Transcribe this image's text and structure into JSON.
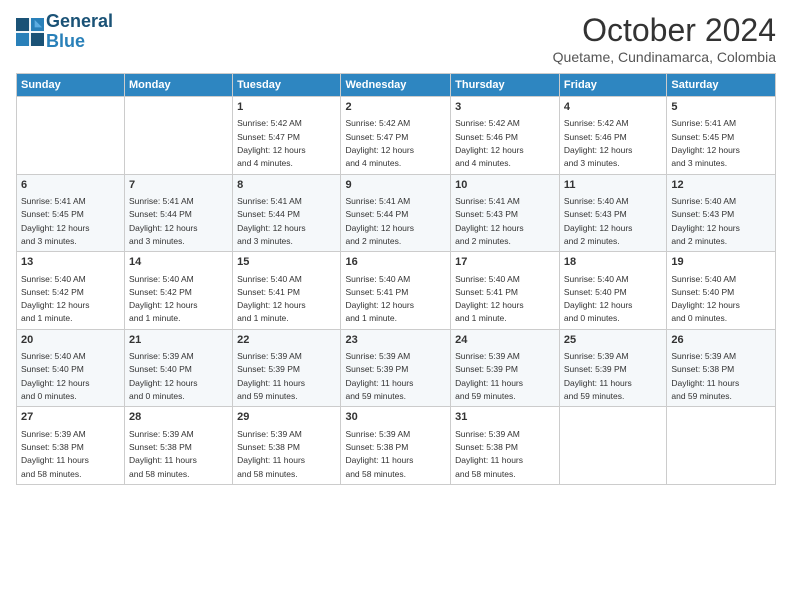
{
  "logo": {
    "line1": "General",
    "line2": "Blue"
  },
  "title": "October 2024",
  "location": "Quetame, Cundinamarca, Colombia",
  "days_of_week": [
    "Sunday",
    "Monday",
    "Tuesday",
    "Wednesday",
    "Thursday",
    "Friday",
    "Saturday"
  ],
  "weeks": [
    [
      {
        "day": "",
        "info": ""
      },
      {
        "day": "",
        "info": ""
      },
      {
        "day": "1",
        "info": "Sunrise: 5:42 AM\nSunset: 5:47 PM\nDaylight: 12 hours\nand 4 minutes."
      },
      {
        "day": "2",
        "info": "Sunrise: 5:42 AM\nSunset: 5:47 PM\nDaylight: 12 hours\nand 4 minutes."
      },
      {
        "day": "3",
        "info": "Sunrise: 5:42 AM\nSunset: 5:46 PM\nDaylight: 12 hours\nand 4 minutes."
      },
      {
        "day": "4",
        "info": "Sunrise: 5:42 AM\nSunset: 5:46 PM\nDaylight: 12 hours\nand 3 minutes."
      },
      {
        "day": "5",
        "info": "Sunrise: 5:41 AM\nSunset: 5:45 PM\nDaylight: 12 hours\nand 3 minutes."
      }
    ],
    [
      {
        "day": "6",
        "info": "Sunrise: 5:41 AM\nSunset: 5:45 PM\nDaylight: 12 hours\nand 3 minutes."
      },
      {
        "day": "7",
        "info": "Sunrise: 5:41 AM\nSunset: 5:44 PM\nDaylight: 12 hours\nand 3 minutes."
      },
      {
        "day": "8",
        "info": "Sunrise: 5:41 AM\nSunset: 5:44 PM\nDaylight: 12 hours\nand 3 minutes."
      },
      {
        "day": "9",
        "info": "Sunrise: 5:41 AM\nSunset: 5:44 PM\nDaylight: 12 hours\nand 2 minutes."
      },
      {
        "day": "10",
        "info": "Sunrise: 5:41 AM\nSunset: 5:43 PM\nDaylight: 12 hours\nand 2 minutes."
      },
      {
        "day": "11",
        "info": "Sunrise: 5:40 AM\nSunset: 5:43 PM\nDaylight: 12 hours\nand 2 minutes."
      },
      {
        "day": "12",
        "info": "Sunrise: 5:40 AM\nSunset: 5:43 PM\nDaylight: 12 hours\nand 2 minutes."
      }
    ],
    [
      {
        "day": "13",
        "info": "Sunrise: 5:40 AM\nSunset: 5:42 PM\nDaylight: 12 hours\nand 1 minute."
      },
      {
        "day": "14",
        "info": "Sunrise: 5:40 AM\nSunset: 5:42 PM\nDaylight: 12 hours\nand 1 minute."
      },
      {
        "day": "15",
        "info": "Sunrise: 5:40 AM\nSunset: 5:41 PM\nDaylight: 12 hours\nand 1 minute."
      },
      {
        "day": "16",
        "info": "Sunrise: 5:40 AM\nSunset: 5:41 PM\nDaylight: 12 hours\nand 1 minute."
      },
      {
        "day": "17",
        "info": "Sunrise: 5:40 AM\nSunset: 5:41 PM\nDaylight: 12 hours\nand 1 minute."
      },
      {
        "day": "18",
        "info": "Sunrise: 5:40 AM\nSunset: 5:40 PM\nDaylight: 12 hours\nand 0 minutes."
      },
      {
        "day": "19",
        "info": "Sunrise: 5:40 AM\nSunset: 5:40 PM\nDaylight: 12 hours\nand 0 minutes."
      }
    ],
    [
      {
        "day": "20",
        "info": "Sunrise: 5:40 AM\nSunset: 5:40 PM\nDaylight: 12 hours\nand 0 minutes."
      },
      {
        "day": "21",
        "info": "Sunrise: 5:39 AM\nSunset: 5:40 PM\nDaylight: 12 hours\nand 0 minutes."
      },
      {
        "day": "22",
        "info": "Sunrise: 5:39 AM\nSunset: 5:39 PM\nDaylight: 11 hours\nand 59 minutes."
      },
      {
        "day": "23",
        "info": "Sunrise: 5:39 AM\nSunset: 5:39 PM\nDaylight: 11 hours\nand 59 minutes."
      },
      {
        "day": "24",
        "info": "Sunrise: 5:39 AM\nSunset: 5:39 PM\nDaylight: 11 hours\nand 59 minutes."
      },
      {
        "day": "25",
        "info": "Sunrise: 5:39 AM\nSunset: 5:39 PM\nDaylight: 11 hours\nand 59 minutes."
      },
      {
        "day": "26",
        "info": "Sunrise: 5:39 AM\nSunset: 5:38 PM\nDaylight: 11 hours\nand 59 minutes."
      }
    ],
    [
      {
        "day": "27",
        "info": "Sunrise: 5:39 AM\nSunset: 5:38 PM\nDaylight: 11 hours\nand 58 minutes."
      },
      {
        "day": "28",
        "info": "Sunrise: 5:39 AM\nSunset: 5:38 PM\nDaylight: 11 hours\nand 58 minutes."
      },
      {
        "day": "29",
        "info": "Sunrise: 5:39 AM\nSunset: 5:38 PM\nDaylight: 11 hours\nand 58 minutes."
      },
      {
        "day": "30",
        "info": "Sunrise: 5:39 AM\nSunset: 5:38 PM\nDaylight: 11 hours\nand 58 minutes."
      },
      {
        "day": "31",
        "info": "Sunrise: 5:39 AM\nSunset: 5:38 PM\nDaylight: 11 hours\nand 58 minutes."
      },
      {
        "day": "",
        "info": ""
      },
      {
        "day": "",
        "info": ""
      }
    ]
  ]
}
